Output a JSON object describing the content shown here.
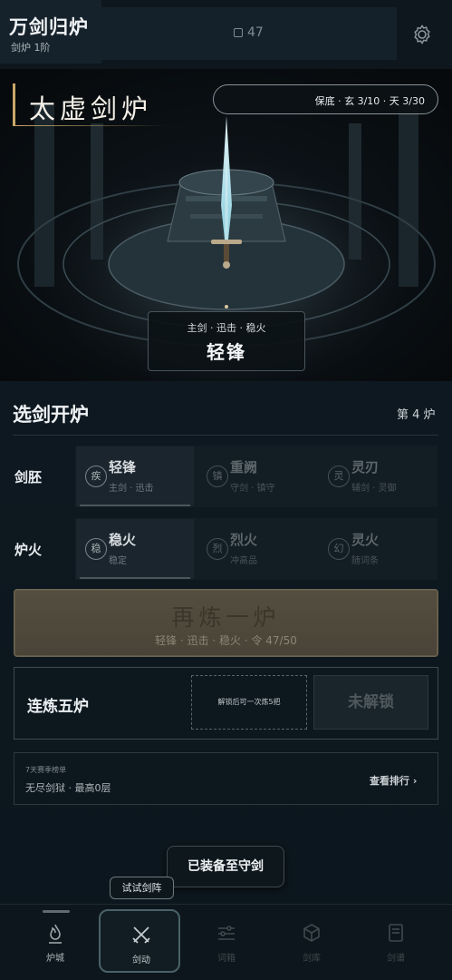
{
  "header": {
    "title": "万剑归炉",
    "subtitle": "剑炉 1阶",
    "currency": "47"
  },
  "hero": {
    "title": "太虚剑炉",
    "pity": "保底 · 玄 3/10 · 天 3/30",
    "blade_tags": "主剑 · 迅击 · 稳火",
    "blade_name": "轻锋"
  },
  "forge": {
    "title": "选剑开炉",
    "furnace_no": "第 4 炉",
    "embryo_label": "剑胚",
    "embryos": [
      {
        "icon": "疾",
        "name": "轻锋",
        "desc": "主剑 · 迅击",
        "selected": true
      },
      {
        "icon": "镇",
        "name": "重阙",
        "desc": "守剑 · 镇守",
        "selected": false
      },
      {
        "icon": "灵",
        "name": "灵刃",
        "desc": "辅剑 · 灵御",
        "selected": false
      }
    ],
    "fire_label": "炉火",
    "fires": [
      {
        "icon": "稳",
        "name": "稳火",
        "desc": "稳定",
        "selected": true
      },
      {
        "icon": "烈",
        "name": "烈火",
        "desc": "冲高品",
        "selected": false
      },
      {
        "icon": "幻",
        "name": "灵火",
        "desc": "随词条",
        "selected": false
      }
    ],
    "main_button": "再炼一炉",
    "main_button_sub": "轻锋 · 迅击 · 稳火 · 令 47/50",
    "five": {
      "label": "连炼五炉",
      "hint": "解锁后可一次炼5把",
      "lock": "未解锁"
    },
    "rank": {
      "tag": "7天赛季榜单",
      "text": "无尽剑狱 · 最高0层",
      "link": "查看排行 ›"
    }
  },
  "toast": "已装备至守剑",
  "trial_button": "试试剑阵",
  "tabs": [
    {
      "label": "炉城"
    },
    {
      "label": "剑动"
    },
    {
      "label": "词箱"
    },
    {
      "label": "剑库"
    },
    {
      "label": "剑谱"
    }
  ]
}
